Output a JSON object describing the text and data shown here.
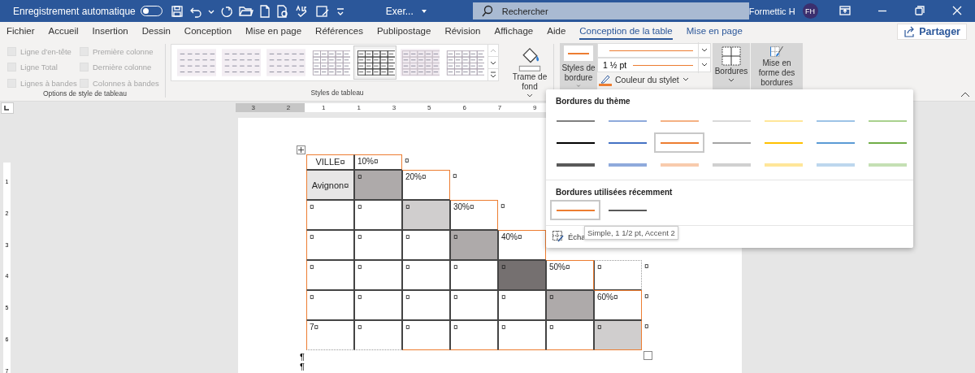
{
  "title_bar": {
    "autosave": {
      "label": "Enregistrement automatique",
      "on": false
    },
    "document_title": "Exer...",
    "search": {
      "placeholder": "Rechercher"
    },
    "user_name": "Formettic H",
    "avatar": "FH"
  },
  "tabs": [
    {
      "label": "Fichier",
      "selected": false,
      "kind": "normal"
    },
    {
      "label": "Accueil",
      "selected": false,
      "kind": "normal"
    },
    {
      "label": "Insertion",
      "selected": false,
      "kind": "normal"
    },
    {
      "label": "Dessin",
      "selected": false,
      "kind": "normal"
    },
    {
      "label": "Conception",
      "selected": false,
      "kind": "normal"
    },
    {
      "label": "Mise en page",
      "selected": false,
      "kind": "normal"
    },
    {
      "label": "Références",
      "selected": false,
      "kind": "normal"
    },
    {
      "label": "Publipostage",
      "selected": false,
      "kind": "normal"
    },
    {
      "label": "Révision",
      "selected": false,
      "kind": "normal"
    },
    {
      "label": "Affichage",
      "selected": false,
      "kind": "normal"
    },
    {
      "label": "Aide",
      "selected": false,
      "kind": "normal"
    },
    {
      "label": "Conception de la table",
      "selected": true,
      "kind": "contextual"
    },
    {
      "label": "Mise en page",
      "selected": false,
      "kind": "contextual"
    }
  ],
  "share_button": "Partager",
  "ribbon": {
    "options_group": {
      "label": "Options de style de tableau",
      "checkboxes": [
        {
          "label": "Ligne d’en-tête",
          "checked": false,
          "disabled": true
        },
        {
          "label": "Première colonne",
          "checked": false,
          "disabled": true
        },
        {
          "label": "Ligne Total",
          "checked": false,
          "disabled": true
        },
        {
          "label": "Dernière colonne",
          "checked": false,
          "disabled": true
        },
        {
          "label": "Lignes à bandes",
          "checked": false,
          "disabled": true
        },
        {
          "label": "Colonnes à bandes",
          "checked": false,
          "disabled": true
        }
      ]
    },
    "styles_group": {
      "label": "Styles de tableau",
      "styles": [
        {
          "kind": "plain",
          "selected": false
        },
        {
          "kind": "plain",
          "selected": false
        },
        {
          "kind": "plain",
          "selected": false
        },
        {
          "kind": "grid",
          "selected": false
        },
        {
          "kind": "grid-dark",
          "selected": true
        },
        {
          "kind": "banded",
          "selected": false
        },
        {
          "kind": "grid",
          "selected": false
        }
      ]
    },
    "shading_button": {
      "label": "Trame de fond"
    },
    "borders_group": {
      "border_styles_button": {
        "label": "Styles de bordure",
        "pressed": true,
        "color": "#ed7d31"
      },
      "line_style": {
        "color": "#ed7d31"
      },
      "line_weight": {
        "value": "1 ½ pt",
        "color": "#ed7d31"
      },
      "pen_color_button": {
        "label": "Couleur du stylet",
        "color": "#ed7d31"
      },
      "borders_button": {
        "label": "Bordures",
        "pressed": true
      },
      "border_painter_button": {
        "label": "Mise en forme des bordures",
        "pressed": true
      }
    }
  },
  "dropdown": {
    "theme_heading": "Bordures du thème",
    "theme_borders": [
      {
        "kind": "thin",
        "color": "#7f7f7f",
        "selected": false
      },
      {
        "kind": "thin",
        "color": "#8eaadb",
        "selected": false
      },
      {
        "kind": "thin",
        "color": "#f4b183",
        "selected": false
      },
      {
        "kind": "thin",
        "color": "#d9d9d9",
        "selected": false
      },
      {
        "kind": "thin",
        "color": "#ffe699",
        "selected": false
      },
      {
        "kind": "thin",
        "color": "#9dc3e6",
        "selected": false
      },
      {
        "kind": "thin",
        "color": "#a9d18e",
        "selected": false
      },
      {
        "kind": "medium",
        "color": "#000000",
        "selected": false
      },
      {
        "kind": "medium",
        "color": "#4472c4",
        "selected": false
      },
      {
        "kind": "medium",
        "color": "#ed7d31",
        "selected": true
      },
      {
        "kind": "medium",
        "color": "#a5a5a5",
        "selected": false
      },
      {
        "kind": "medium",
        "color": "#ffc000",
        "selected": false
      },
      {
        "kind": "medium",
        "color": "#5b9bd5",
        "selected": false
      },
      {
        "kind": "medium",
        "color": "#70ad47",
        "selected": false
      },
      {
        "kind": "thick",
        "color": "#595959",
        "selected": false
      },
      {
        "kind": "thick",
        "color": "#8faadc",
        "selected": false
      },
      {
        "kind": "thick",
        "color": "#f8cbad",
        "selected": false
      },
      {
        "kind": "thick",
        "color": "#d0d0d0",
        "selected": false
      },
      {
        "kind": "thick",
        "color": "#ffe699",
        "selected": false
      },
      {
        "kind": "thick",
        "color": "#bdd7ee",
        "selected": false
      },
      {
        "kind": "thick",
        "color": "#c5e0b4",
        "selected": false
      }
    ],
    "recent_heading": "Bordures utilisées récemment",
    "recent_borders": [
      {
        "kind": "medium",
        "color": "#ed7d31",
        "selected": true
      },
      {
        "kind": "medium",
        "color": "#595959",
        "selected": false
      }
    ],
    "footer_item": "Écha",
    "tooltip": "Simple, 1 1/2 pt, Accent 2"
  },
  "ruler": {
    "labels": [
      "3",
      "2",
      "1",
      "1",
      "3",
      "5",
      "6",
      "7",
      "9"
    ]
  },
  "vertical_ruler": {
    "labels": [
      "1",
      "2",
      "3",
      "4",
      "5",
      "6",
      "7"
    ]
  },
  "table": {
    "rows": [
      {
        "end_mark": "¤",
        "cells": [
          {
            "text": "VILLE¤",
            "kind": "label",
            "accent_top": true,
            "accent_left": true
          },
          {
            "text": "10%¤",
            "kind": "data",
            "accent_top": true,
            "accent_right": true
          }
        ]
      },
      {
        "end_mark": "¤",
        "cells": [
          {
            "text": "Avignon¤",
            "kind": "label",
            "color": "#e7e6e6",
            "accent_left": true
          },
          {
            "text": "¤",
            "kind": "data",
            "color": "#aeaaaa"
          },
          {
            "text": "20%¤",
            "kind": "data",
            "accent_top": true,
            "accent_right": true
          }
        ]
      },
      {
        "end_mark": "¤",
        "cells": [
          {
            "text": "¤",
            "kind": "data",
            "accent_left": true
          },
          {
            "text": "¤",
            "kind": "data"
          },
          {
            "text": "¤",
            "kind": "data",
            "color": "#d0cece"
          },
          {
            "text": "30%¤",
            "kind": "data",
            "accent_top": true,
            "accent_right": true
          }
        ]
      },
      {
        "cells": [
          {
            "text": "¤",
            "kind": "data",
            "accent_left": true
          },
          {
            "text": "¤",
            "kind": "data"
          },
          {
            "text": "¤",
            "kind": "data"
          },
          {
            "text": "¤",
            "kind": "data",
            "color": "#aeaaaa"
          },
          {
            "text": "40%¤",
            "kind": "data",
            "accent_top": true,
            "accent_right": true
          }
        ]
      },
      {
        "end_mark": "¤",
        "cells": [
          {
            "text": "¤",
            "kind": "data",
            "accent_left": true
          },
          {
            "text": "¤",
            "kind": "data"
          },
          {
            "text": "¤",
            "kind": "data"
          },
          {
            "text": "¤",
            "kind": "data"
          },
          {
            "text": "¤",
            "kind": "data",
            "color": "#757070"
          },
          {
            "text": "50%¤",
            "kind": "data",
            "accent_top": true,
            "accent_right": true
          },
          {
            "text": "¤",
            "kind": "data",
            "dotted": true
          }
        ]
      },
      {
        "end_mark": "¤",
        "cells": [
          {
            "text": "¤",
            "kind": "data",
            "accent_left": true
          },
          {
            "text": "¤",
            "kind": "data"
          },
          {
            "text": "¤",
            "kind": "data"
          },
          {
            "text": "¤",
            "kind": "data"
          },
          {
            "text": "¤",
            "kind": "data"
          },
          {
            "text": "¤",
            "kind": "data",
            "color": "#aeaaaa"
          },
          {
            "text": "60%¤",
            "kind": "data",
            "accent_top": true,
            "accent_right": true
          }
        ]
      },
      {
        "end_mark": "¤",
        "cells": [
          {
            "text": "7¤",
            "kind": "data",
            "accent_left": true,
            "dotted": true
          },
          {
            "text": "¤",
            "kind": "data",
            "dotted": true
          },
          {
            "text": "¤",
            "kind": "data",
            "accent_bottom": true
          },
          {
            "text": "¤",
            "kind": "data",
            "accent_bottom": true
          },
          {
            "text": "¤",
            "kind": "data",
            "accent_bottom": true
          },
          {
            "text": "¤",
            "kind": "data",
            "accent_bottom": true
          },
          {
            "text": "¤",
            "kind": "data",
            "color": "#d0cece",
            "accent_bottom": true,
            "accent_right": true
          }
        ]
      }
    ]
  },
  "paragraph_marks": [
    "¶",
    "¶"
  ]
}
